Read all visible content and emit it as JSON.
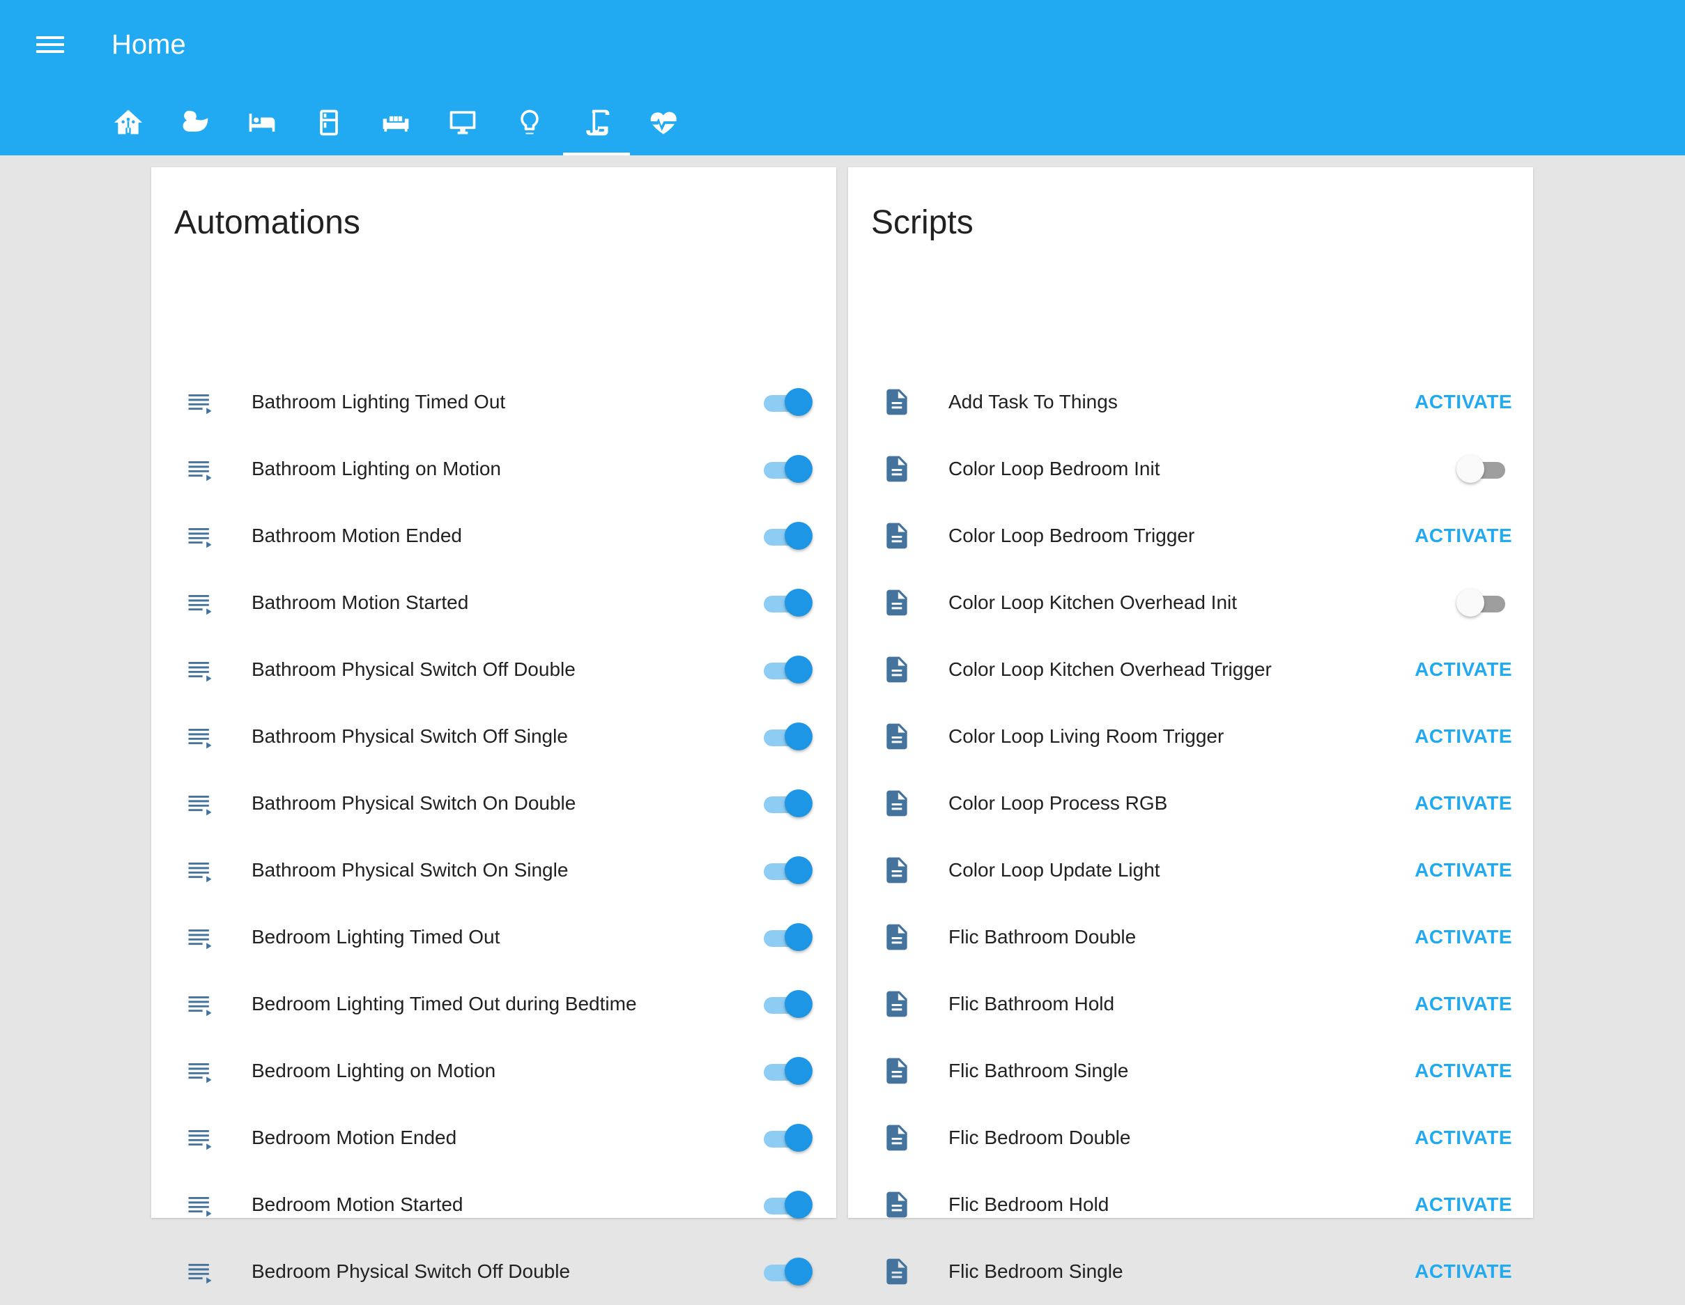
{
  "app": {
    "title": "Home"
  },
  "tabs": [
    {
      "icon": "home-assistant-icon"
    },
    {
      "icon": "duck-icon"
    },
    {
      "icon": "bed-icon"
    },
    {
      "icon": "fridge-icon"
    },
    {
      "icon": "sofa-icon"
    },
    {
      "icon": "monitor-icon"
    },
    {
      "icon": "lightbulb-icon"
    },
    {
      "icon": "script-icon"
    },
    {
      "icon": "heart-pulse-icon"
    }
  ],
  "active_tab_index": 7,
  "automations": {
    "title": "Automations",
    "items": [
      {
        "label": "Bathroom Lighting Timed Out",
        "state": "on"
      },
      {
        "label": "Bathroom Lighting on Motion",
        "state": "on"
      },
      {
        "label": "Bathroom Motion Ended",
        "state": "on"
      },
      {
        "label": "Bathroom Motion Started",
        "state": "on"
      },
      {
        "label": "Bathroom Physical Switch Off Double",
        "state": "on"
      },
      {
        "label": "Bathroom Physical Switch Off Single",
        "state": "on"
      },
      {
        "label": "Bathroom Physical Switch On Double",
        "state": "on"
      },
      {
        "label": "Bathroom Physical Switch On Single",
        "state": "on"
      },
      {
        "label": "Bedroom Lighting Timed Out",
        "state": "on"
      },
      {
        "label": "Bedroom Lighting Timed Out during Bedtime",
        "state": "on"
      },
      {
        "label": "Bedroom Lighting on Motion",
        "state": "on"
      },
      {
        "label": "Bedroom Motion Ended",
        "state": "on"
      },
      {
        "label": "Bedroom Motion Started",
        "state": "on"
      },
      {
        "label": "Bedroom Physical Switch Off Double",
        "state": "on"
      }
    ]
  },
  "scripts": {
    "title": "Scripts",
    "activate_label": "ACTIVATE",
    "items": [
      {
        "label": "Add Task To Things",
        "control": "activate"
      },
      {
        "label": "Color Loop Bedroom Init",
        "control": "toggle",
        "state": "off"
      },
      {
        "label": "Color Loop Bedroom Trigger",
        "control": "activate"
      },
      {
        "label": "Color Loop Kitchen Overhead Init",
        "control": "toggle",
        "state": "off"
      },
      {
        "label": "Color Loop Kitchen Overhead Trigger",
        "control": "activate"
      },
      {
        "label": "Color Loop Living Room Trigger",
        "control": "activate"
      },
      {
        "label": "Color Loop Process RGB",
        "control": "activate"
      },
      {
        "label": "Color Loop Update Light",
        "control": "activate"
      },
      {
        "label": "Flic Bathroom Double",
        "control": "activate"
      },
      {
        "label": "Flic Bathroom Hold",
        "control": "activate"
      },
      {
        "label": "Flic Bathroom Single",
        "control": "activate"
      },
      {
        "label": "Flic Bedroom Double",
        "control": "activate"
      },
      {
        "label": "Flic Bedroom Hold",
        "control": "activate"
      },
      {
        "label": "Flic Bedroom Single",
        "control": "activate"
      }
    ]
  },
  "colors": {
    "appbar": "#21aaf1",
    "accent": "#21aaf1",
    "toggle_on": "#1e96e6",
    "row_icon": "#44739e"
  }
}
